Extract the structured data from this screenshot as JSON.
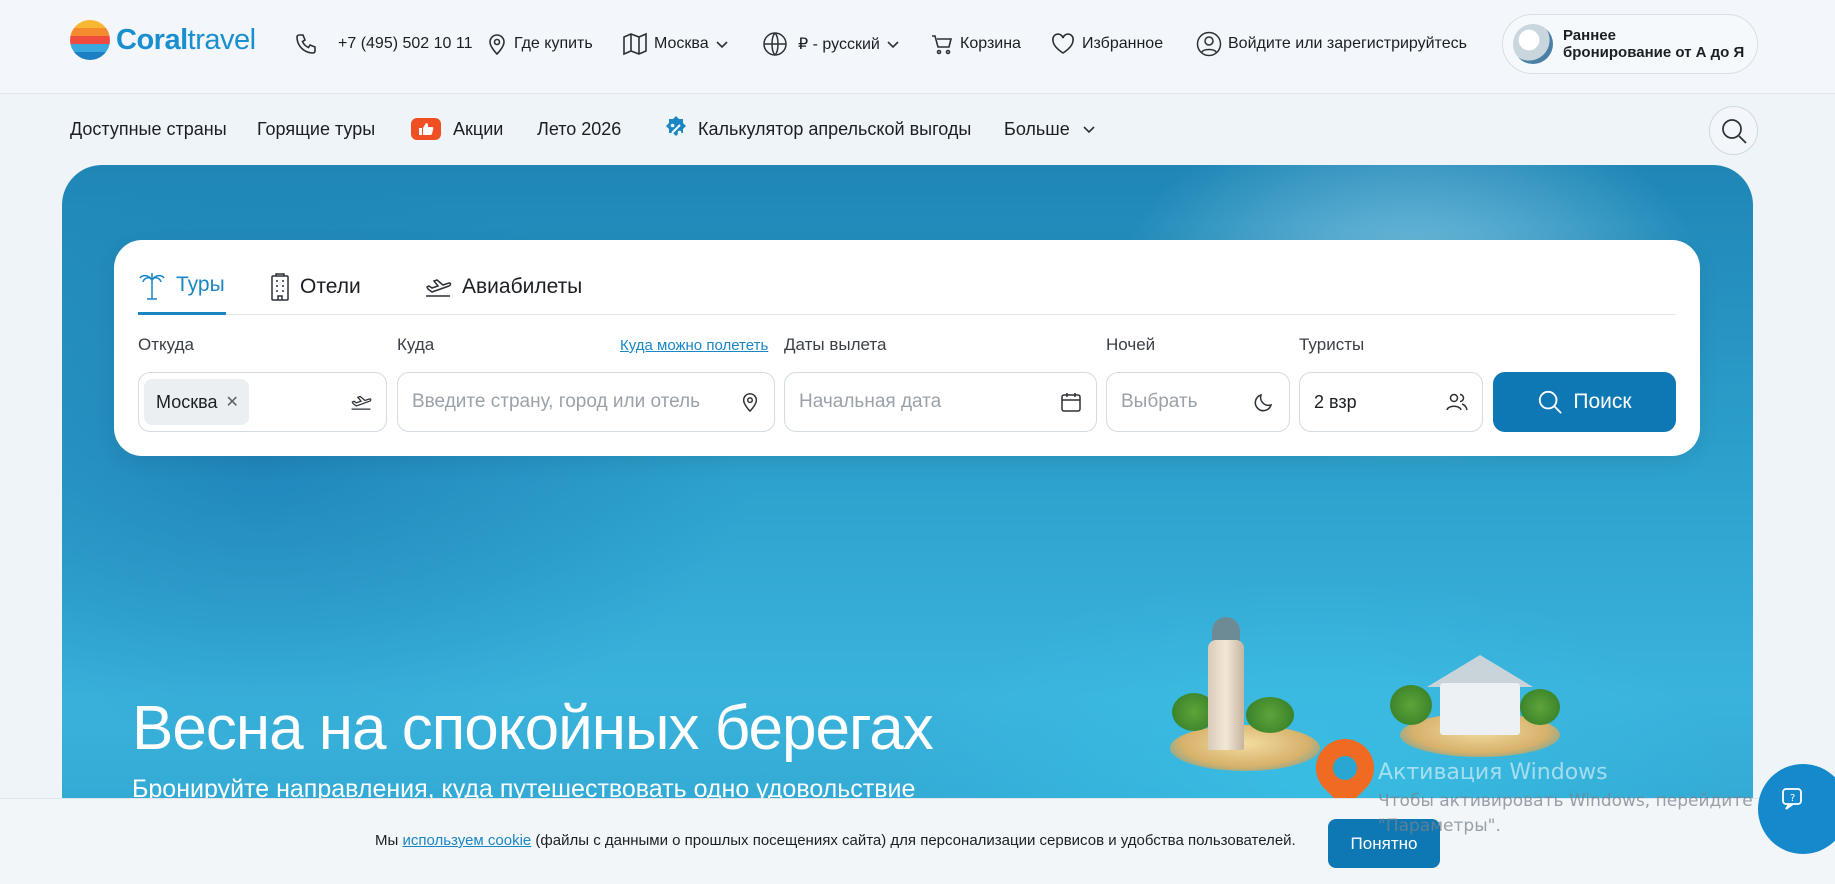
{
  "header": {
    "logo_bold": "Coral",
    "logo_light": "travel",
    "phone": "+7 (495) 502 10 11",
    "where_to_buy": "Где купить",
    "city": "Москва",
    "currency_language": "₽ - русский",
    "cart": "Корзина",
    "favorites": "Избранное",
    "login": "Войдите или зарегистрируйтесь",
    "promo_line1": "Раннее",
    "promo_line2": "бронирование от А до Я"
  },
  "subnav": {
    "items": [
      {
        "label": "Доступные страны"
      },
      {
        "label": "Горящие туры"
      },
      {
        "label": "Акции"
      },
      {
        "label": "Лето 2026"
      },
      {
        "label": "Калькулятор апрельской выгоды"
      },
      {
        "label": "Больше"
      }
    ]
  },
  "search": {
    "tabs": [
      {
        "label": "Туры",
        "active": true
      },
      {
        "label": "Отели",
        "active": false
      },
      {
        "label": "Авиабилеты",
        "active": false
      }
    ],
    "from_label": "Откуда",
    "from_value": "Москва",
    "to_label": "Куда",
    "to_link": "Куда можно полететь",
    "to_placeholder": "Введите страну, город или отель",
    "dates_label": "Даты вылета",
    "dates_placeholder": "Начальная дата",
    "nights_label": "Ночей",
    "nights_placeholder": "Выбрать",
    "tourists_label": "Туристы",
    "tourists_value": "2 взр",
    "button": "Поиск"
  },
  "hero": {
    "title": "Весна на спокойных берегах",
    "subtitle": "Бронируйте направления, куда путешествовать одно удовольствие"
  },
  "cookie": {
    "text_before": "Мы ",
    "link": "используем cookie",
    "text_after": " (файлы с данными о прошлых посещениях сайта) для персонализации сервисов и удобства пользователей.",
    "button": "Понятно"
  },
  "watermark": {
    "title": "Активация Windows",
    "line1": "Чтобы активировать Windows, перейдите в раздел",
    "line2": "\"Параметры\"."
  },
  "colors": {
    "accent": "#0e78b4",
    "link": "#1a86c4",
    "promo_badge": "#f04e23"
  }
}
